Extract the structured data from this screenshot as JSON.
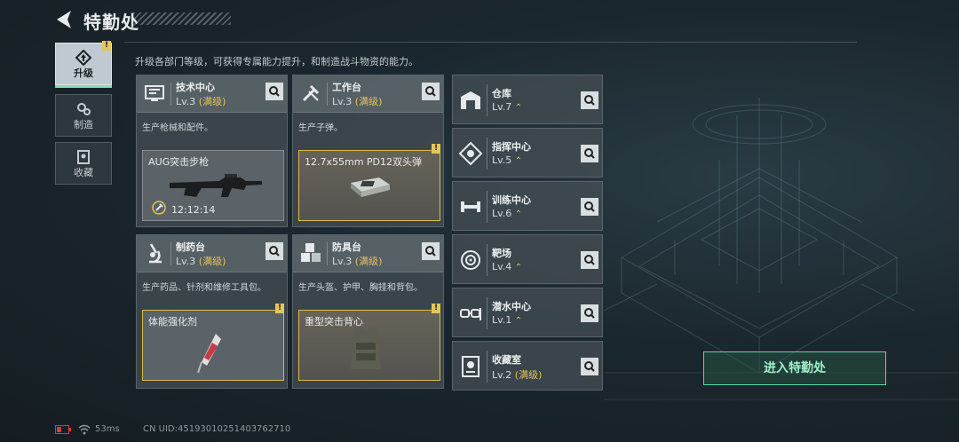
{
  "header": {
    "title": "特勤处"
  },
  "description": "升级各部门等级，可获得专属能力提升，和制造战斗物资的能力。",
  "nav": [
    {
      "label": "升级",
      "active": true,
      "badge": "!"
    },
    {
      "label": "制造",
      "active": false
    },
    {
      "label": "收藏",
      "active": false
    }
  ],
  "cards": [
    {
      "name": "技术中心",
      "level": "Lv.3",
      "max": "(满级)",
      "desc": "生产枪械和配件。",
      "slot": {
        "name": "AUG突击步枪",
        "timer": "12:12:14"
      }
    },
    {
      "name": "工作台",
      "level": "Lv.3",
      "max": "(满级)",
      "desc": "生产子弹。",
      "slot": {
        "name": "12.7x55mm PD12双头弹",
        "badge": "!"
      }
    },
    {
      "name": "制药台",
      "level": "Lv.3",
      "max": "(满级)",
      "desc": "生产药品、针剂和维修工具包。",
      "slot": {
        "name": "体能强化剂",
        "badge": "!"
      }
    },
    {
      "name": "防具台",
      "level": "Lv.3",
      "max": "(满级)",
      "desc": "生产头盔、护甲、胸挂和背包。",
      "slot": {
        "name": "重型突击背心",
        "badge": "!"
      }
    }
  ],
  "departments": [
    {
      "name": "仓库",
      "level": "Lv.7",
      "upgrade": "⌃"
    },
    {
      "name": "指挥中心",
      "level": "Lv.5",
      "upgrade": "⌃"
    },
    {
      "name": "训练中心",
      "level": "Lv.6",
      "upgrade": "⌃"
    },
    {
      "name": "靶场",
      "level": "Lv.4",
      "upgrade": "⌃"
    },
    {
      "name": "潜水中心",
      "level": "Lv.1",
      "upgrade": "⌃"
    },
    {
      "name": "收藏室",
      "level": "Lv.2",
      "max": "(满级)"
    }
  ],
  "enter_button": "进入特勤处",
  "footer": {
    "ping": "53ms",
    "uid": "CN UID:45193010251403762710"
  },
  "colors": {
    "accent_green": "#5fd6a2",
    "max_gold": "#e3c25a",
    "badge_yellow": "#e4c65a"
  }
}
